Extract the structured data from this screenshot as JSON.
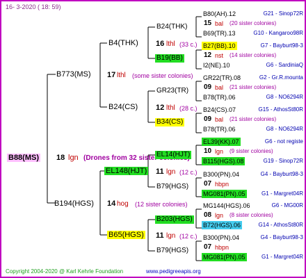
{
  "colors": {
    "frame": "#c000c0",
    "green": "#22dd22",
    "yellow": "#ffff00",
    "cyan": "#44ccee",
    "pink": "#ffc0ff"
  },
  "header": {
    "date": "16- 3-2020 ( 18: 59)"
  },
  "footer": {
    "copyright": "Copyright 2004-2020 @ Karl Kehrle Foundation",
    "site": "www.pedigreeapis.org"
  },
  "root": {
    "id": "B88(MS)",
    "gen": "18",
    "line": "lgn",
    "note": "(Drones from 32 sister colonies)"
  },
  "g1": {
    "sire": {
      "id": "B773(MS)",
      "gen": "17",
      "line": "lthl",
      "note": "(some sister colonies)"
    },
    "dam": {
      "id": "B194(HGS)",
      "gen": "14",
      "line": "hog",
      "note": "(12 sister colonies)"
    }
  },
  "g2": {
    "b4": {
      "id": "B4(THK)",
      "gen": "16",
      "line": "lthl",
      "note": "(33 c.)"
    },
    "b24": {
      "id": "B24(CS)",
      "gen": "12",
      "line": "lthl",
      "note": "(28 c.)"
    },
    "el148": {
      "id": "EL148(HJT)",
      "gen": "11",
      "line": "lgn",
      "note": "(12 c.)"
    },
    "b65": {
      "id": "B65(HGS)",
      "gen": "11",
      "line": "lgn",
      "note": "(12 c.)"
    }
  },
  "g3": {
    "b24thk": {
      "id": "B24(THK)"
    },
    "b19bb": {
      "id": "B19(BB)"
    },
    "gr23": {
      "id": "GR23(TR)"
    },
    "b34cs": {
      "id": "B34(CS)"
    },
    "el14": {
      "id": "EL14(HJT)"
    },
    "b79a": {
      "id": "B79(HGS)"
    },
    "b203": {
      "id": "B203(HGS)"
    },
    "b79b": {
      "id": "B79(HGS)"
    }
  },
  "g4": [
    {
      "sire": "B80(AH).12",
      "sire_code": "G21 - Sinop72R",
      "gen": "15",
      "line": "bal",
      "note": "(20 sister colonies)",
      "dam": "B69(TR).13",
      "dam_code": "G10 - Kangaroo98R"
    },
    {
      "sire": "B27(BB).10",
      "sire_code": "G7 - Bayburt98-3",
      "gen": "12",
      "line": "nst",
      "note": "(14 sister colonies)",
      "dam": "I2(NE).10",
      "dam_code": "G6 - SardiniaQ"
    },
    {
      "sire": "GR22(TR).08",
      "sire_code": "G2 - Gr.R.mounta",
      "gen": "09",
      "line": "bal",
      "note": "(21 sister colonies)",
      "dam": "B78(TR).06",
      "dam_code": "G8 - NO6294R"
    },
    {
      "sire": "B24(CS).07",
      "sire_code": "G15 - AthosSt80R",
      "gen": "09",
      "line": "bal",
      "note": "(21 sister colonies)",
      "dam": "B78(TR).06",
      "dam_code": "G8 - NO6294R"
    },
    {
      "sire": "EL39(KK).07",
      "sire_code": "G6 - not registe",
      "gen": "10",
      "line": "lgn",
      "note": "(9 sister colonies)",
      "dam": "B115(HGS).08",
      "dam_code": "G19 - Sinop72R"
    },
    {
      "sire": "B300(PN).04",
      "sire_code": "G4 - Bayburt98-3",
      "gen": "07",
      "line": "hbpn",
      "note": "",
      "dam": "MG081(PN).05",
      "dam_code": "G1 - Margret04R"
    },
    {
      "sire": "MG144(HGS).06",
      "sire_code": "G6 - MG00R",
      "gen": "08",
      "line": "lgn",
      "note": "(8 sister colonies)",
      "dam": "B72(HGS).06",
      "dam_code": "G14 - AthosSt80R"
    },
    {
      "sire": "B300(PN).04",
      "sire_code": "G4 - Bayburt98-3",
      "gen": "07",
      "line": "hbpn",
      "note": "",
      "dam": "MG081(PN).05",
      "dam_code": "G1 - Margret04R"
    }
  ]
}
